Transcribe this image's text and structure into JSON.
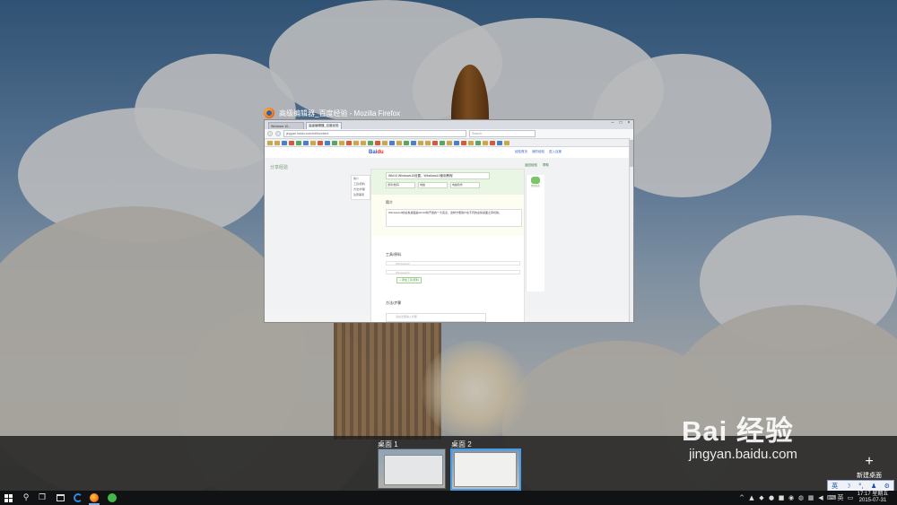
{
  "window": {
    "title": "高级编辑器_百度经验 - Mozilla Firefox",
    "tabs": [
      "Windows 10...",
      "高级编辑器_百度经验"
    ],
    "url": "jingyan.baidu.com/edit/content",
    "search_placeholder": "Search"
  },
  "page": {
    "logo_bai": "Bai",
    "logo_du": "du",
    "header_links": [
      "经验首页",
      "我的经验",
      "进入百度"
    ],
    "section_heading": "分享经验",
    "top_right_links": [
      "返回经验",
      "帮助"
    ],
    "title_value": "Win10 Windows10设置，Windows10使用教程",
    "category_selects": [
      "游戏/数码",
      "电脑",
      "电脑软件"
    ],
    "side_nav": [
      "简介",
      "工具/原料",
      "方法/步骤",
      "注意事项"
    ],
    "intro_heading": "简介",
    "intro_text": "Windows10的虚拟桌面是Win10新开发的一大亮点，这样方便用户在不同的虚拟桌面之间切换。",
    "tools_heading": "工具/原料",
    "tool_placeholders": [
      "Windows10",
      "Windows10"
    ],
    "add_tool_button": "+ 添加工具/原料",
    "steps_heading": "方法/步骤",
    "step_placeholder": "请在这里输入步骤",
    "right_panel_label": "经验助手"
  },
  "taskview": {
    "desktops": [
      {
        "label": "桌面 1",
        "selected": false
      },
      {
        "label": "桌面 2",
        "selected": true
      }
    ],
    "new_desktop_label": "新建桌面",
    "new_desktop_icon": "+"
  },
  "watermark": {
    "main": "Bai 经验",
    "url": "jingyan.baidu.com"
  },
  "ime": [
    "英",
    "☽",
    "°,",
    "♟",
    "⚙"
  ],
  "taskbar": {
    "clock_time": "17:17 星期五",
    "clock_date": "2015-07-31"
  },
  "colors": {
    "accent": "#4a9be6",
    "taskbar": "#111214",
    "baidu_blue": "#2b58d6",
    "baidu_red": "#e1251b",
    "editor_green": "#e9f6e4"
  }
}
